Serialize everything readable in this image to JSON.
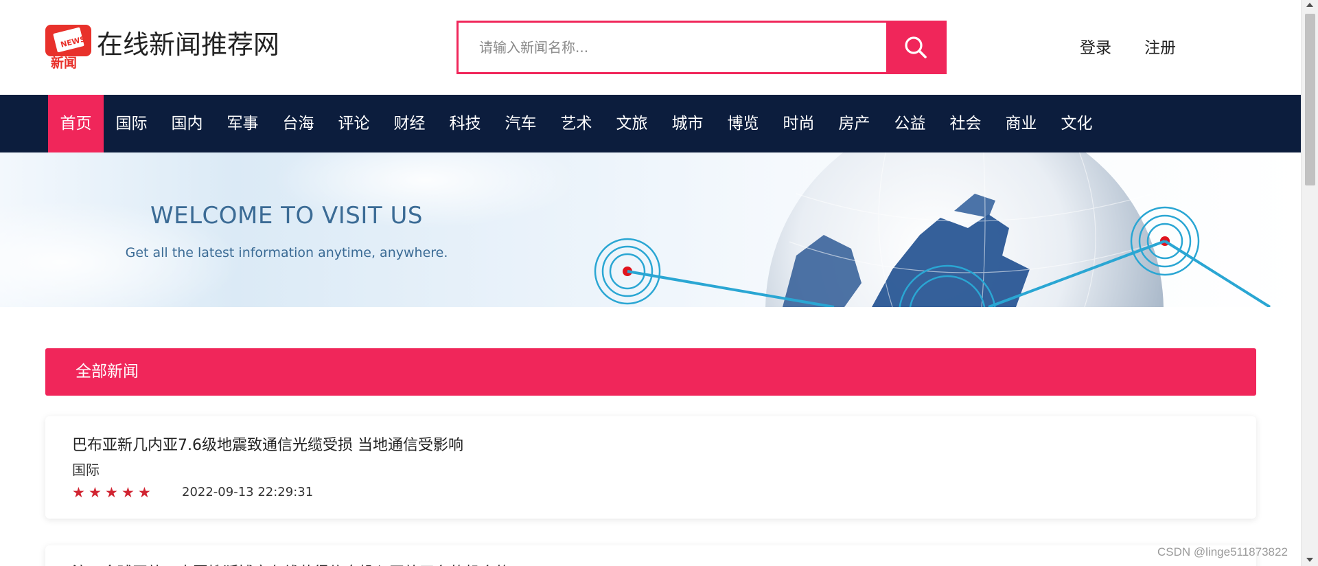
{
  "header": {
    "logo_text": "NEWS",
    "logo_label": "新闻",
    "site_title": "在线新闻推荐网",
    "search": {
      "placeholder": "请输入新闻名称..."
    },
    "login": "登录",
    "register": "注册"
  },
  "nav": {
    "items": [
      "首页",
      "国际",
      "国内",
      "军事",
      "台海",
      "评论",
      "财经",
      "科技",
      "汽车",
      "艺术",
      "文旅",
      "城市",
      "博览",
      "时尚",
      "房产",
      "公益",
      "社会",
      "商业",
      "文化"
    ]
  },
  "banner": {
    "title": "WELCOME TO VISIT US",
    "subtitle": "Get all the latest information anytime, anywhere."
  },
  "section": {
    "title": "全部新闻"
  },
  "news": [
    {
      "title": "巴布亚新几内亚7.6级地震致通信光缆受损 当地通信受影响",
      "category": "国际",
      "rating": 5,
      "date": "2022-09-13 22:29:31"
    },
    {
      "title": "注：全球开放，中国搜狐博客在线获得信息投入开放平台的机会的"
    }
  ],
  "watermark": "CSDN @linge511873822",
  "colors": {
    "accent": "#f0265a",
    "nav_bg": "#0c1d3d",
    "star": "#d12431",
    "banner_text": "#3b6b95"
  }
}
